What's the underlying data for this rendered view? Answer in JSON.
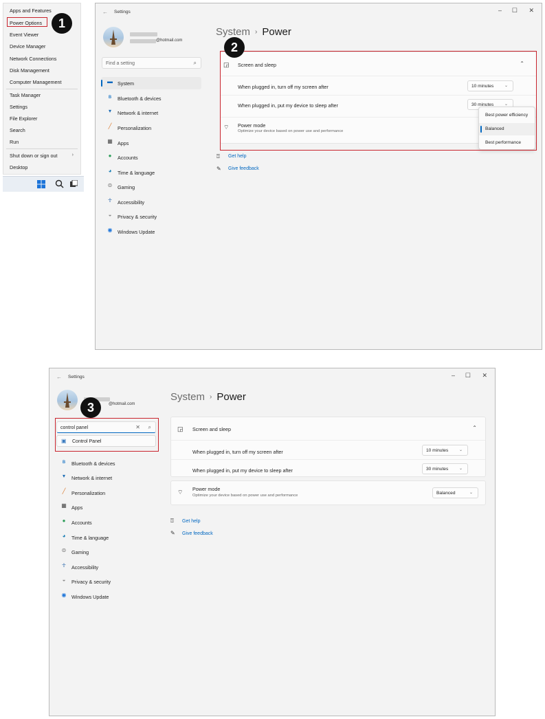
{
  "badges": [
    "1",
    "2",
    "3"
  ],
  "winx_menu": {
    "items": [
      {
        "label": "Apps and Features"
      },
      {
        "label": "Power Options"
      },
      {
        "label": "Event Viewer"
      },
      {
        "label": "Device Manager"
      },
      {
        "label": "Network Connections"
      },
      {
        "label": "Disk Management"
      },
      {
        "label": "Computer Management"
      },
      {
        "label": "Task Manager"
      },
      {
        "label": "Settings"
      },
      {
        "label": "File Explorer"
      },
      {
        "label": "Search"
      },
      {
        "label": "Run"
      },
      {
        "label": "Shut down or sign out"
      },
      {
        "label": "Desktop"
      }
    ],
    "submenu_glyph": "›",
    "highlighted": "Power Options"
  },
  "taskbar": {
    "icons": [
      "windows-start-icon",
      "search-icon",
      "task-view-icon"
    ]
  },
  "settings": {
    "title": "Settings",
    "window_controls": [
      "–",
      "☐",
      "✕"
    ],
    "back_glyph": "←",
    "account_email": "@hotmail.com",
    "search_placeholder": "Find a setting",
    "search_value": "control panel",
    "search_result": "Control Panel",
    "nav": [
      {
        "label": "System",
        "icon": "system-icon"
      },
      {
        "label": "Bluetooth & devices",
        "icon": "bluetooth-icon"
      },
      {
        "label": "Network & internet",
        "icon": "wifi-icon"
      },
      {
        "label": "Personalization",
        "icon": "brush-icon"
      },
      {
        "label": "Apps",
        "icon": "apps-icon"
      },
      {
        "label": "Accounts",
        "icon": "person-icon"
      },
      {
        "label": "Time & language",
        "icon": "globe-clock-icon"
      },
      {
        "label": "Gaming",
        "icon": "gamepad-icon"
      },
      {
        "label": "Accessibility",
        "icon": "accessibility-icon"
      },
      {
        "label": "Privacy & security",
        "icon": "shield-icon"
      },
      {
        "label": "Windows Update",
        "icon": "update-icon"
      }
    ],
    "breadcrumb": {
      "parent": "System",
      "separator": "›",
      "current": "Power"
    },
    "screen_sleep": {
      "title": "Screen and sleep",
      "screen_label": "When plugged in, turn off my screen after",
      "screen_value": "10 minutes",
      "sleep_label": "When plugged in, put my device to sleep after",
      "sleep_value": "30 minutes"
    },
    "power_mode": {
      "title": "Power mode",
      "subtitle": "Optimize your device based on power use and performance",
      "value": "Balanced",
      "options": [
        "Best power efficiency",
        "Balanced",
        "Best performance"
      ]
    },
    "links": {
      "help": "Get help",
      "feedback": "Give feedback"
    }
  },
  "colors": {
    "highlight_red": "#c8232c",
    "accent_blue": "#0067c0"
  }
}
